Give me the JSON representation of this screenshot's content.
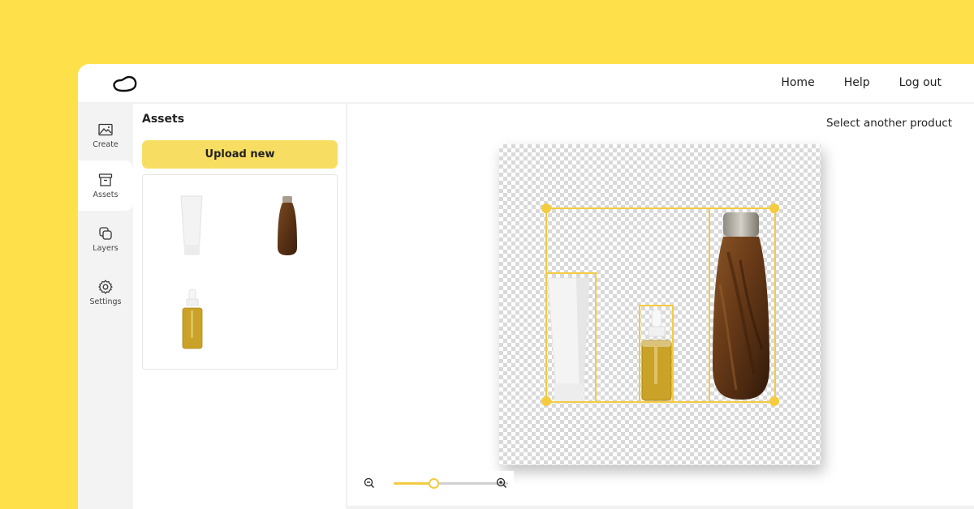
{
  "header": {
    "logo": "cloud-blob-logo",
    "nav": [
      {
        "label": "Home"
      },
      {
        "label": "Help"
      },
      {
        "label": "Log out"
      }
    ]
  },
  "sidebar": {
    "items": [
      {
        "label": "Create",
        "icon": "image-icon",
        "active": false
      },
      {
        "label": "Assets",
        "icon": "archive-box-icon",
        "active": true
      },
      {
        "label": "Layers",
        "icon": "layers-icon",
        "active": false
      },
      {
        "label": "Settings",
        "icon": "gear-icon",
        "active": false
      }
    ]
  },
  "assets": {
    "title": "Assets",
    "upload_label": "Upload new",
    "items": [
      {
        "name": "white-tube"
      },
      {
        "name": "wood-bottle"
      },
      {
        "name": "serum-dropper-bottle"
      }
    ]
  },
  "canvas": {
    "select_product_label": "Select another product",
    "products": [
      {
        "name": "white-tube"
      },
      {
        "name": "serum-dropper-bottle"
      },
      {
        "name": "wood-bottle"
      }
    ],
    "zoom": {
      "value": 0.35
    }
  },
  "colors": {
    "background": "#FEE04A",
    "accent": "#F5CB3F",
    "button": "#F7DE62"
  }
}
